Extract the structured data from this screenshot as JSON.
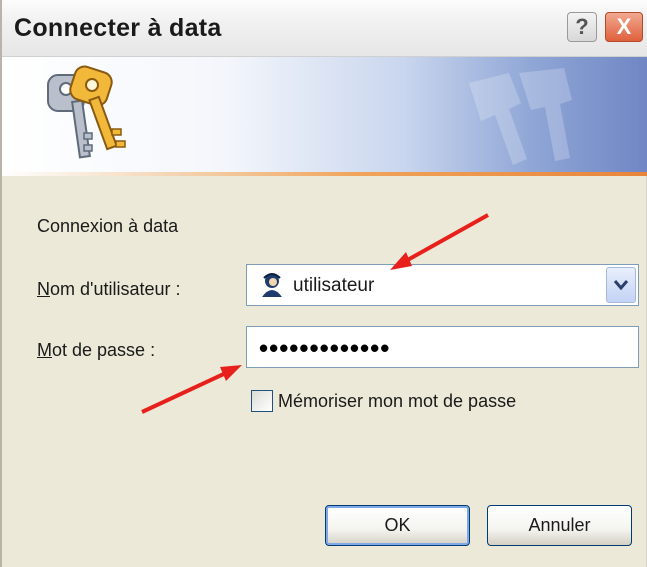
{
  "window": {
    "title": "Connecter à data",
    "help_glyph": "?",
    "close_glyph": "X"
  },
  "dialog": {
    "intro_text": "Connexion à data",
    "username_label": "Nom d'utilisateur :",
    "username_value": "utilisateur",
    "password_label": "Mot de passe :",
    "password_value": "•••••••••••••",
    "remember_label": "Mémoriser mon mot de passe",
    "remember_checked": false,
    "ok_label": "OK",
    "cancel_label": "Annuler"
  },
  "icons": {
    "banner": "keys-icon",
    "user": "user-icon",
    "dropdown": "chevron-down-icon"
  },
  "colors": {
    "annotation_arrow": "#e8201c",
    "banner_accent": "#e8843a",
    "button_border": "#003c74"
  }
}
